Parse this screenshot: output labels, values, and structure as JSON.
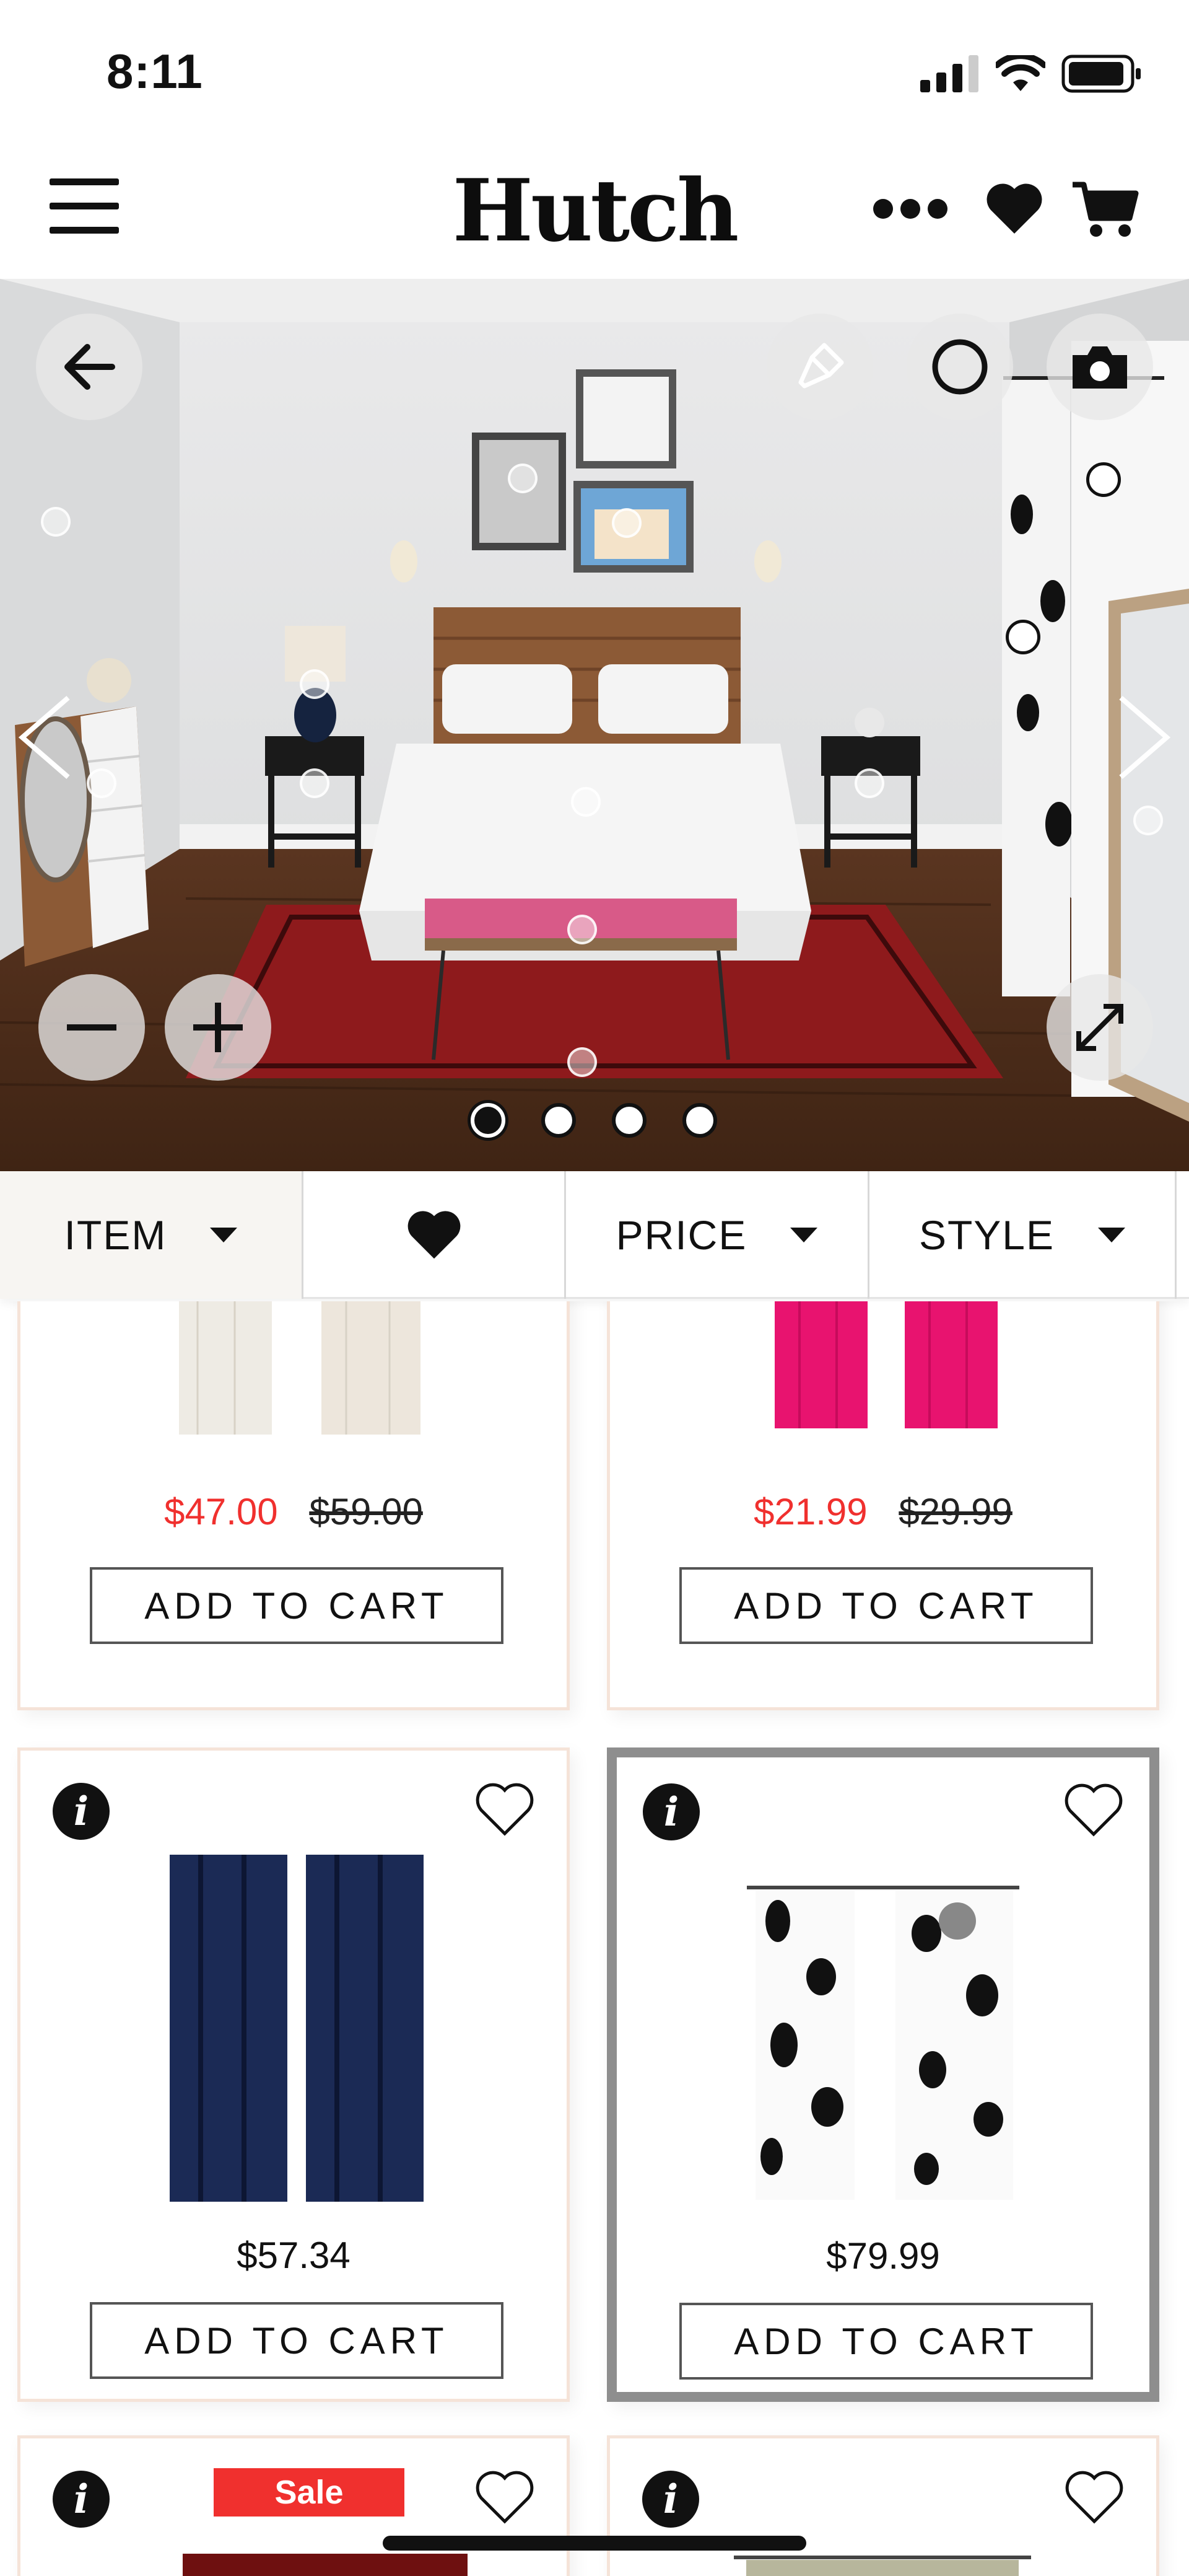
{
  "status_bar": {
    "time": "8:11"
  },
  "header": {
    "title": "Hutch"
  },
  "filters": {
    "item": "ITEM",
    "price": "PRICE",
    "style": "STYLE"
  },
  "products": [
    {
      "sale_price": "$47.00",
      "original_price": "$59.00",
      "cta": "ADD TO CART"
    },
    {
      "sale_price": "$21.99",
      "original_price": "$29.99",
      "cta": "ADD TO CART"
    },
    {
      "price": "$57.34",
      "cta": "ADD TO CART"
    },
    {
      "price": "$79.99",
      "cta": "ADD TO CART"
    },
    {
      "badge": "Sale"
    },
    {}
  ],
  "icons": [
    "menu-icon",
    "more-icon",
    "heart-icon",
    "cart-icon",
    "back-arrow-icon",
    "paint-brush-icon",
    "circle-icon",
    "camera-icon",
    "chevron-left-icon",
    "chevron-right-icon",
    "minus-icon",
    "plus-icon",
    "expand-icon",
    "info-icon",
    "heart-outline-icon"
  ],
  "colors": {
    "sale_red": "#f0302e",
    "selected_border": "#8e8e8e",
    "card_border": "#f5e3d8"
  }
}
